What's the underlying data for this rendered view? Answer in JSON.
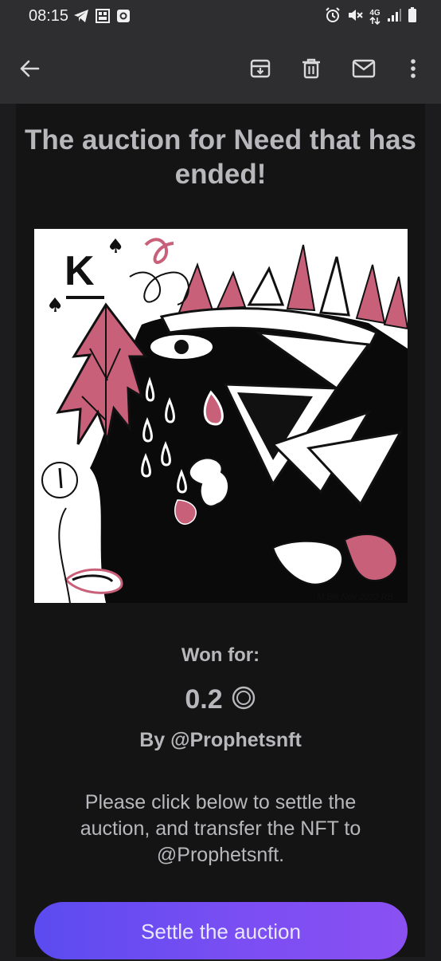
{
  "status_bar": {
    "time": "08:15",
    "left_icons": [
      "telegram-icon",
      "gallery-icon",
      "outlook-icon"
    ],
    "right_icons": [
      "alarm-icon",
      "mute-icon",
      "network-4g-icon",
      "signal-icon",
      "battery-icon"
    ],
    "network_label": "4G"
  },
  "toolbar": {
    "icons": [
      "back-arrow-icon",
      "archive-icon",
      "delete-icon",
      "mail-icon",
      "more-vert-icon"
    ]
  },
  "email": {
    "title": "The auction for Need that has ended!",
    "artwork_signature": "M.Blk Nov 2022  RB",
    "won_label": "Won for:",
    "price": "0.2",
    "currency_icon": "tezos-circle-icon",
    "by_line": "By @Prophetsnft",
    "instructions": "Please click below to settle the auction, and transfer the NFT to @Prophetsnft.",
    "button_label": "Settle the auction"
  },
  "colors": {
    "background": "#141414",
    "toolbar": "#2e2e31",
    "text": "#b8b8bc",
    "button_start": "#5b4bf0",
    "button_end": "#8a50f2",
    "art_pink": "#c9607a"
  }
}
